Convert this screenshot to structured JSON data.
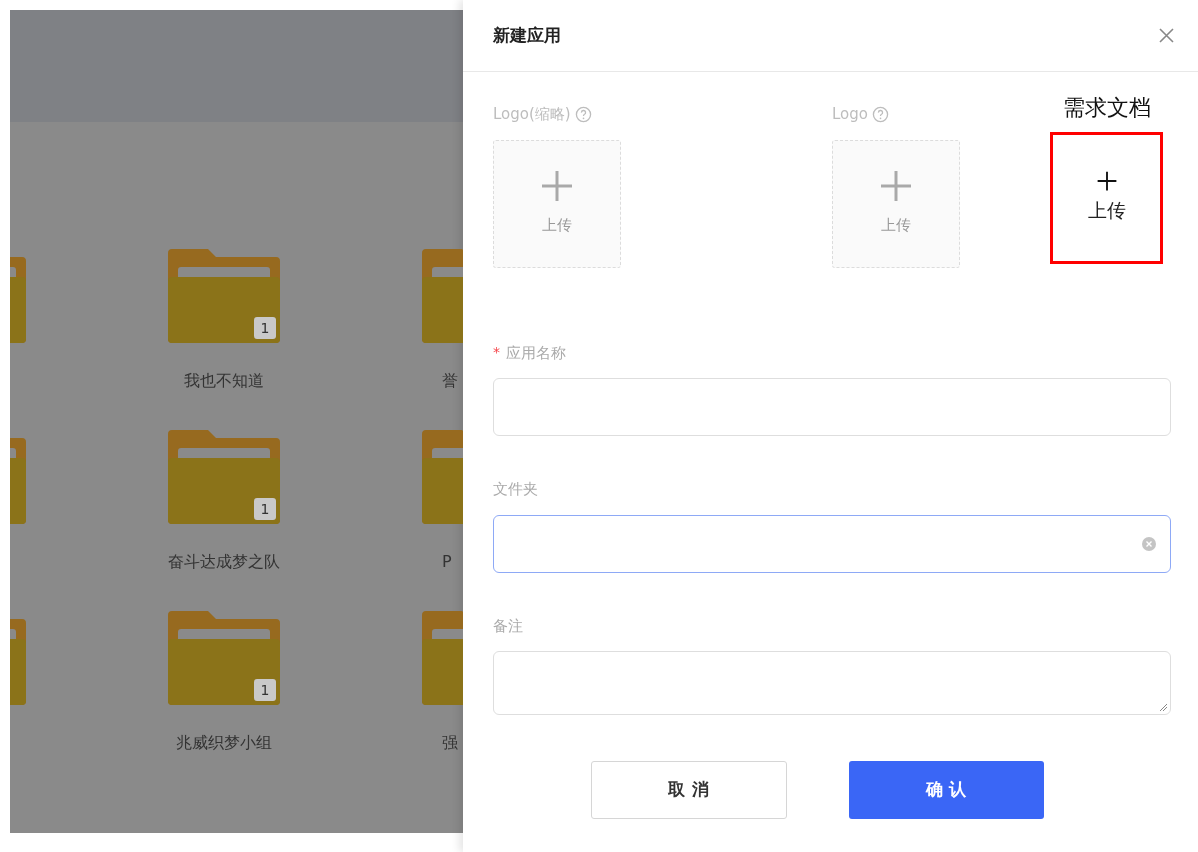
{
  "background": {
    "rows": [
      {
        "center": {
          "label": "我也不知道",
          "badge": "1"
        },
        "right_label": "誉"
      },
      {
        "center": {
          "label": "奋斗达成梦之队",
          "badge": "1"
        },
        "right_label": "P"
      },
      {
        "center": {
          "label": "兆威织梦小组",
          "badge": "1"
        },
        "right_label": "强"
      }
    ]
  },
  "drawer": {
    "title": "新建应用",
    "uploads": [
      {
        "kind": "logo",
        "label": "Logo(缩略)",
        "action": "上传"
      },
      {
        "kind": "logo",
        "label": "Logo",
        "action": "上传"
      },
      {
        "kind": "annotated",
        "label": "需求文档",
        "action": "上传"
      }
    ],
    "fields": [
      {
        "kind": "input",
        "label": "应用名称",
        "required_mark": "*",
        "focused": false,
        "clearable": false
      },
      {
        "kind": "input",
        "label": "文件夹",
        "focused": true,
        "clearable": true
      },
      {
        "kind": "textarea",
        "label": "备注",
        "focused": false
      }
    ],
    "buttons": [
      {
        "label": "取消",
        "primary": false
      },
      {
        "label": "确认",
        "primary": true
      }
    ]
  }
}
